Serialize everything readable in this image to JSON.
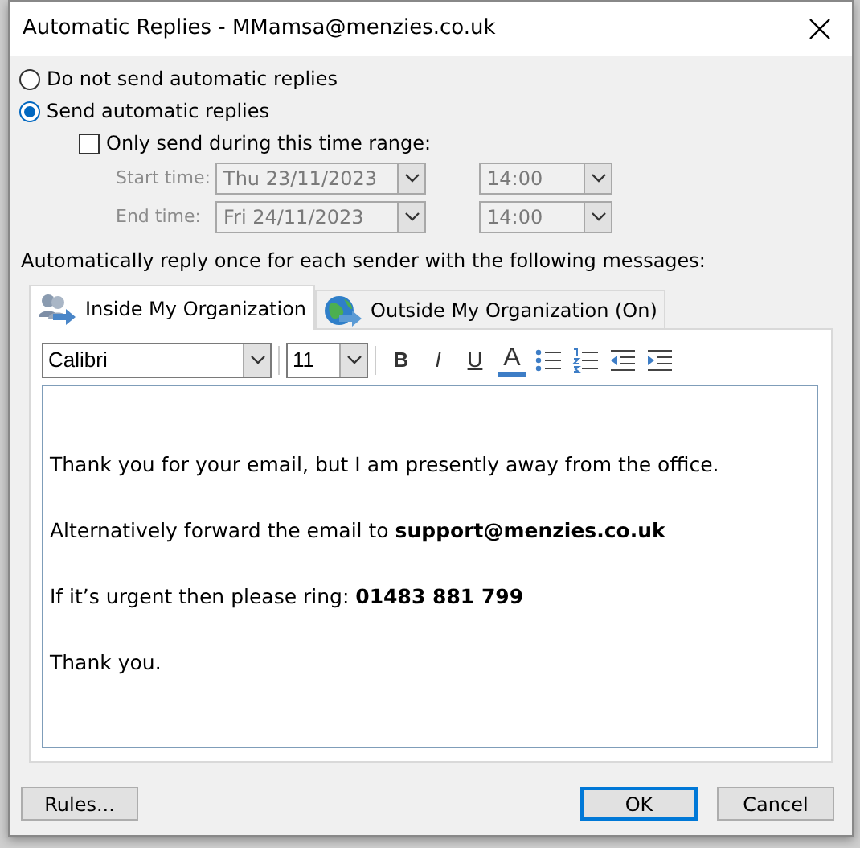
{
  "window": {
    "title": "Automatic Replies - MMamsa@menzies.co.uk"
  },
  "reply_mode": [
    {
      "label": "Do not send automatic replies",
      "selected": false
    },
    {
      "label": "Send automatic replies",
      "selected": true
    }
  ],
  "time_range": {
    "label": "Only send during this time range:",
    "checked": false,
    "disabled": true,
    "rows": [
      {
        "label": "Start time:",
        "date": "Thu 23/11/2023",
        "time": "14:00"
      },
      {
        "label": "End time:",
        "date": "Fri 24/11/2023",
        "time": "14:00"
      }
    ]
  },
  "instruction": "Automatically reply once for each sender with the following messages:",
  "tabs": [
    {
      "label": "Inside My Organization",
      "selected": true,
      "kind": "people"
    },
    {
      "label": "Outside My Organization (On)",
      "selected": false,
      "kind": "globe"
    }
  ],
  "toolbar": {
    "font": "Calibri",
    "size": "11",
    "format_buttons": [
      {
        "label": "B",
        "kind": "bold"
      },
      {
        "label": "I",
        "kind": "italic"
      },
      {
        "label": "U",
        "kind": "underline"
      },
      {
        "label": "A",
        "kind": "color"
      }
    ]
  },
  "message": [
    "Thank you for your email, but I am presently away from the office.",
    "Alternatively forward the email to **support@menzies.co.uk**",
    "If it’s urgent then please ring: **01483 881 799**",
    "Thank you."
  ],
  "buttons": {
    "rules": "Rules...",
    "ok": "OK",
    "cancel": "Cancel"
  }
}
